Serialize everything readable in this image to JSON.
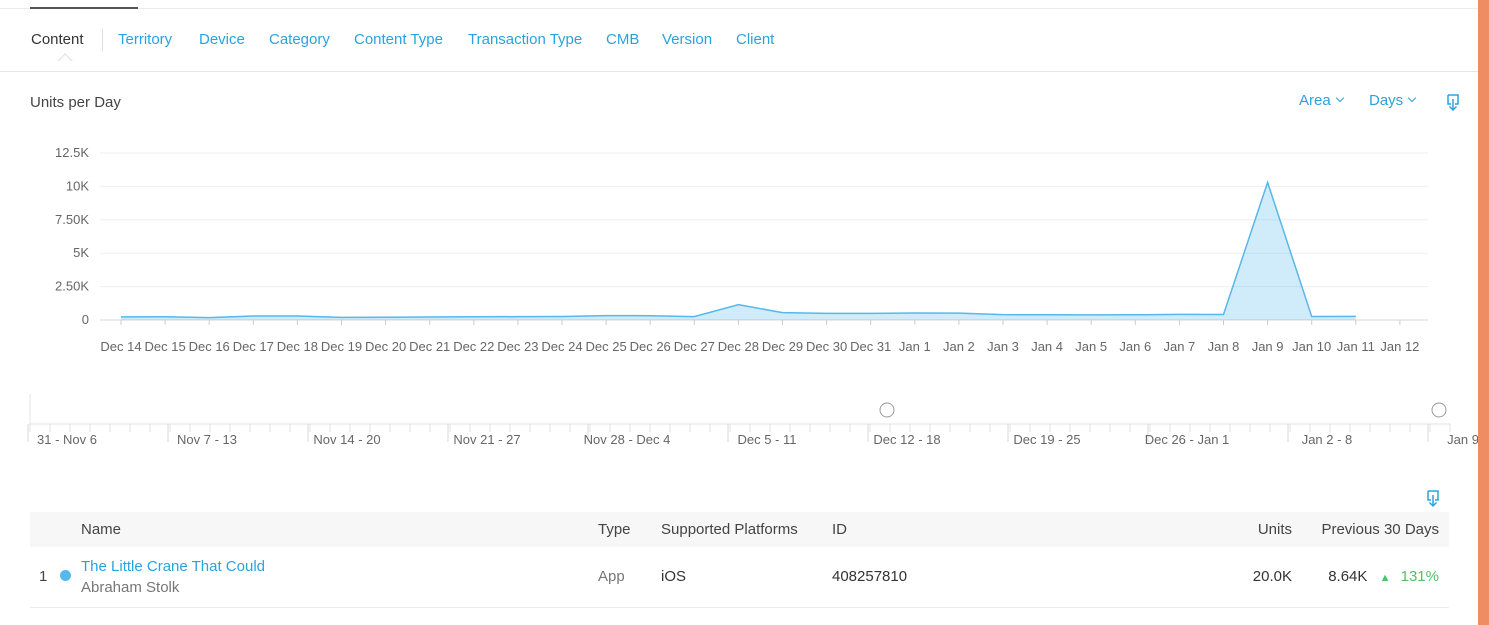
{
  "tabs": [
    {
      "label": "Content",
      "active": true
    },
    {
      "label": "Territory"
    },
    {
      "label": "Device"
    },
    {
      "label": "Category"
    },
    {
      "label": "Content Type"
    },
    {
      "label": "Transaction Type"
    },
    {
      "label": "CMB"
    },
    {
      "label": "Version"
    },
    {
      "label": "Client"
    }
  ],
  "chart_header": {
    "title": "Units per Day",
    "type_select": "Area",
    "interval_select": "Days",
    "download_icon": "download-icon"
  },
  "chart_data": {
    "type": "area",
    "title": "Units per Day",
    "x": [
      "Dec 14",
      "Dec 15",
      "Dec 16",
      "Dec 17",
      "Dec 18",
      "Dec 19",
      "Dec 20",
      "Dec 21",
      "Dec 22",
      "Dec 23",
      "Dec 24",
      "Dec 25",
      "Dec 26",
      "Dec 27",
      "Dec 28",
      "Dec 29",
      "Dec 30",
      "Dec 31",
      "Jan 1",
      "Jan 2",
      "Jan 3",
      "Jan 4",
      "Jan 5",
      "Jan 6",
      "Jan 7",
      "Jan 8",
      "Jan 9",
      "Jan 10",
      "Jan 11",
      "Jan 12"
    ],
    "series": [
      {
        "values": [
          230,
          240,
          180,
          300,
          300,
          200,
          210,
          220,
          240,
          250,
          260,
          330,
          320,
          250,
          1150,
          550,
          500,
          500,
          520,
          510,
          400,
          390,
          380,
          390,
          420,
          410,
          10300,
          260,
          270,
          null
        ]
      }
    ],
    "y_ticks": [
      "0",
      "2.50K",
      "5K",
      "7.50K",
      "10K",
      "12.5K"
    ],
    "ylim": [
      0,
      12500
    ],
    "grid": true,
    "color": "#56b8ec"
  },
  "navigator": {
    "weeks": [
      "31 - Nov 6",
      "Nov 7 - 13",
      "Nov 14 - 20",
      "Nov 21 - 27",
      "Nov 28 - Dec 4",
      "Dec 5 - 11",
      "Dec 12 - 18",
      "Dec 19 - 25",
      "Dec 26 - Jan 1",
      "Jan 2 - 8",
      "Jan 9 -"
    ]
  },
  "table": {
    "download_icon": "download-icon",
    "headers": {
      "name": "Name",
      "type": "Type",
      "platforms": "Supported Platforms",
      "id": "ID",
      "units": "Units",
      "previous": "Previous 30 Days"
    },
    "rows": [
      {
        "rank": "1",
        "name": "The Little Crane That Could",
        "artist": "Abraham Stolk",
        "type": "App",
        "platforms": "iOS",
        "id": "408257810",
        "units": "20.0K",
        "previous": "8.64K",
        "change_icon": "up-triangle-icon",
        "change": "131%",
        "dot_color": "#56b8ec"
      }
    ]
  },
  "colors": {
    "accent": "#2aa3dd",
    "positive": "#4cc26a",
    "side_bar": "#ef8c61"
  }
}
